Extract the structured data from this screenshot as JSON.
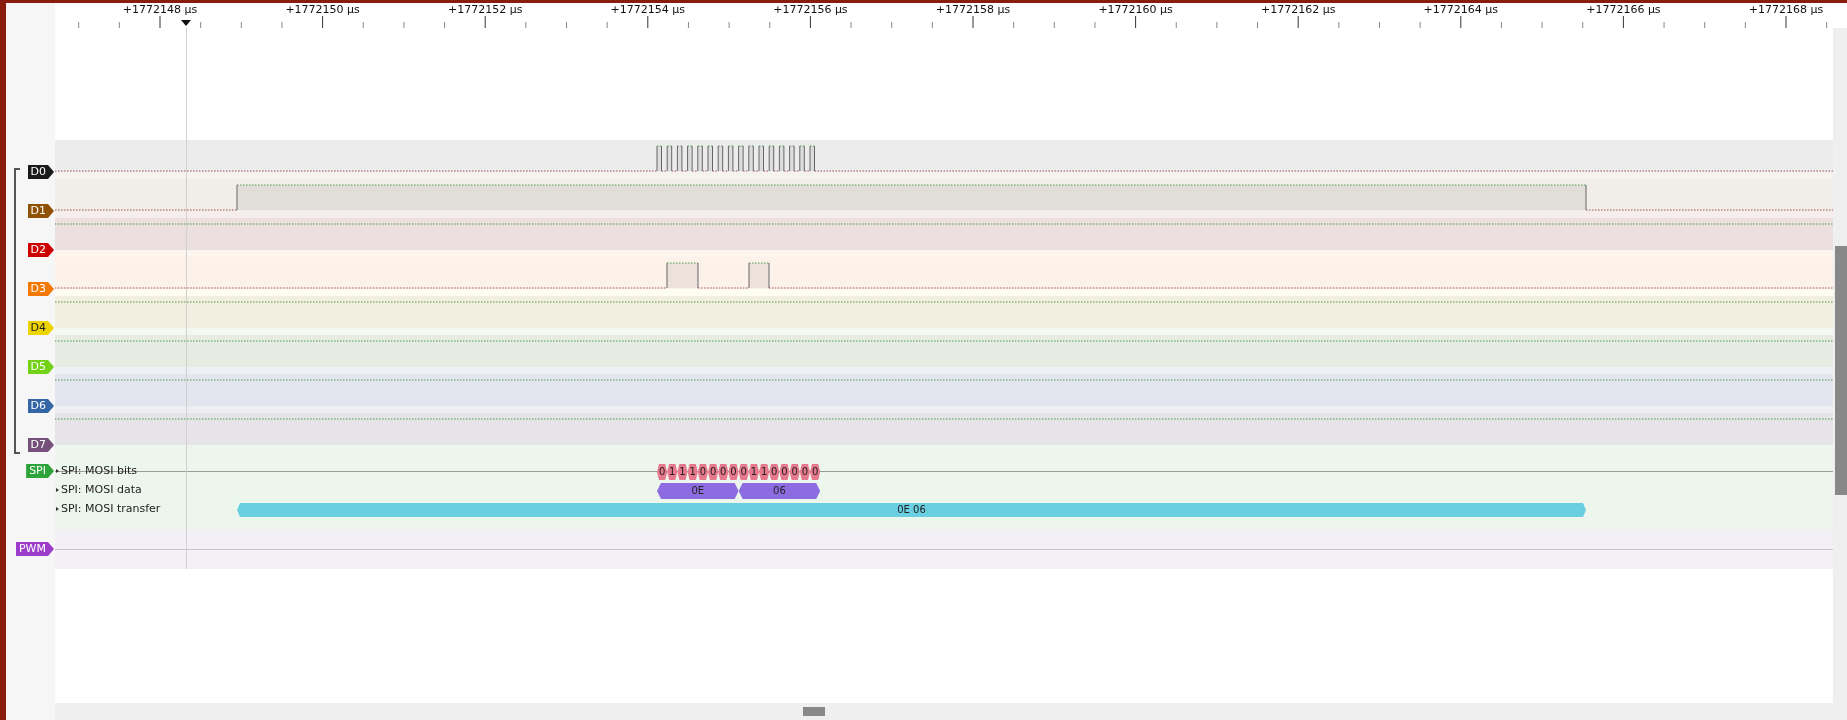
{
  "ruler": {
    "labels": [
      "+1772148 µs",
      "+1772150 µs",
      "+1772152 µs",
      "+1772154 µs",
      "+1772156 µs",
      "+1772158 µs",
      "+1772160 µs",
      "+1772162 µs",
      "+1772164 µs",
      "+1772166 µs",
      "+1772168 µs"
    ]
  },
  "channels": [
    {
      "name": "D0",
      "color": "#1a1a1a"
    },
    {
      "name": "D1",
      "color": "#8f5202"
    },
    {
      "name": "D2",
      "color": "#cc0000"
    },
    {
      "name": "D3",
      "color": "#f57900"
    },
    {
      "name": "D4",
      "color": "#edd400"
    },
    {
      "name": "D5",
      "color": "#73d216"
    },
    {
      "name": "D6",
      "color": "#3465a4"
    },
    {
      "name": "D7",
      "color": "#75507b"
    }
  ],
  "decoders": [
    {
      "name": "SPI",
      "color": "#2ea33a",
      "rows": [
        {
          "label": "SPI: MOSI bits",
          "kind": "bits",
          "annotations": [
            "0",
            "1",
            "1",
            "1",
            "0",
            "0",
            "0",
            "0",
            "0",
            "1",
            "1",
            "0",
            "0",
            "0",
            "0",
            "0"
          ]
        },
        {
          "label": "SPI: MOSI data",
          "kind": "data",
          "annotations": [
            "0E",
            "06"
          ]
        },
        {
          "label": "SPI: MOSI transfer",
          "kind": "transfer",
          "annotations": [
            "0E 06"
          ]
        }
      ]
    }
  ],
  "pwm": {
    "name": "PWM",
    "color": "#9c3dc9"
  }
}
